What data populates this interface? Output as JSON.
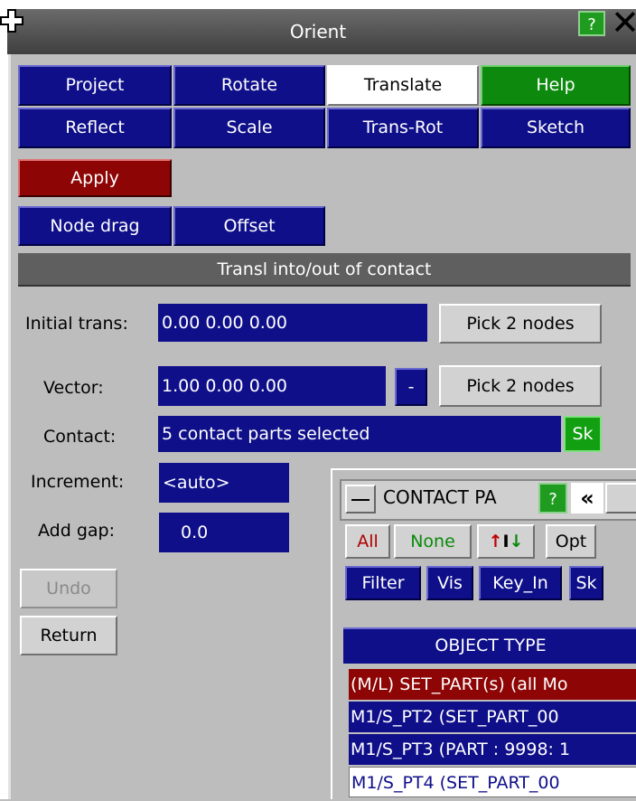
{
  "window": {
    "title": "Orient"
  },
  "tabs_row1": [
    "Project",
    "Rotate",
    "Translate",
    "Help"
  ],
  "tabs_row2": [
    "Reflect",
    "Scale",
    "Trans-Rot",
    "Sketch"
  ],
  "apply_label": "Apply",
  "modes": [
    "Node drag",
    "Offset"
  ],
  "section_title": "Transl into/out of contact",
  "initial_trans": {
    "label": "Initial trans:",
    "value": "0.00 0.00 0.00",
    "pick": "Pick 2 nodes"
  },
  "vector": {
    "label": "Vector:",
    "value": "1.00 0.00 0.00",
    "minus": "-",
    "pick": "Pick 2 nodes"
  },
  "contact": {
    "label": "Contact:",
    "value": "5 contact parts selected",
    "sk": "Sk"
  },
  "increment": {
    "label": "Increment:",
    "value": "<auto>"
  },
  "add_gap": {
    "label": "Add gap:",
    "value": "0.0"
  },
  "undo_label": "Undo",
  "return_label": "Return",
  "subpanel": {
    "title": "CONTACT PA",
    "help": "?",
    "collapse": "«",
    "all": "All",
    "none": "None",
    "swap": "↑I↓",
    "opt": "Opt",
    "filter": "Filter",
    "vis": "Vis",
    "key_in": "Key_In",
    "sk": "Sk",
    "object_type_header": "OBJECT TYPE",
    "rows": [
      "(M/L) SET_PART(s) (all Mo",
      "M1/S_PT2 (SET_PART_00",
      "M1/S_PT3 (PART : 9998: 1",
      "M1/S_PT4 (SET_PART_00"
    ]
  },
  "colors": {
    "button_blue": "#0f0f8a",
    "active_green": "#0d8a0d",
    "apply_red": "#8e0505"
  }
}
